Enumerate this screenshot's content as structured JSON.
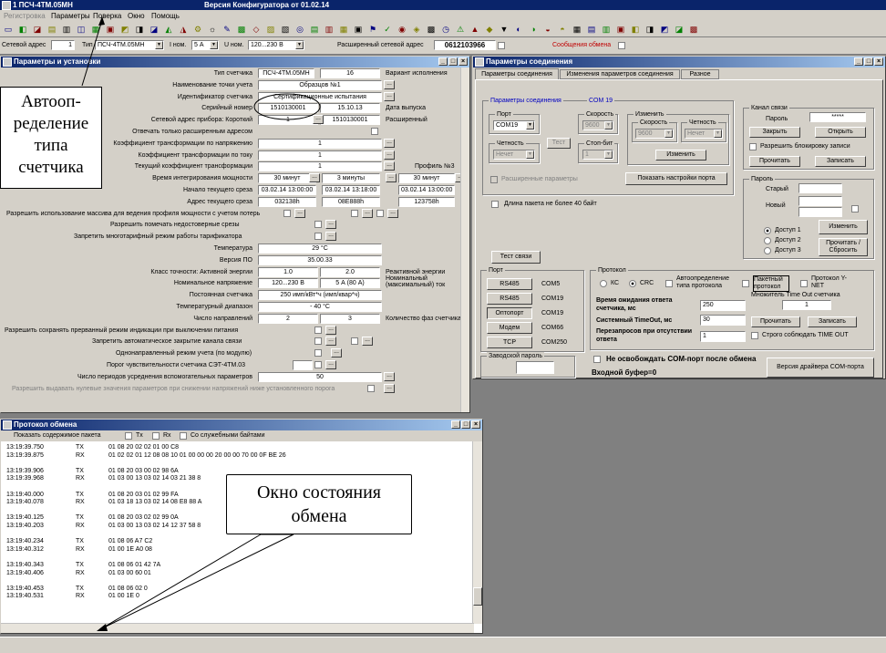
{
  "app": {
    "title": "1 ПСЧ-4ТМ.05МН",
    "center_title": "Версия Конфигуратора  от 01.02.14"
  },
  "menu": [
    "Регистровка",
    "Параметры",
    "Поверка",
    "Окно",
    "Помощь"
  ],
  "addrbar": {
    "net_addr_label": "Сетевой адрес",
    "net_addr_value": "1",
    "type_label": "Тип",
    "type_value": "ПСЧ-4ТМ.05МН",
    "inom_label": "I ном.",
    "inom_value": "5 А",
    "unom_label": "U ном.",
    "unom_value": "120...230 В",
    "ext_label": "Расширенный сетевой адрес",
    "ext_value": "0612103966",
    "msg_label": "Сообщения обмена"
  },
  "params": {
    "title": "Параметры и установки",
    "rows": [
      {
        "label": "Тип счетчика",
        "v1": "ПСЧ-4ТМ.05МН",
        "v2": "16",
        "right": "Вариант исполнения"
      },
      {
        "label": "Наименование точки учета",
        "v1": "Образцов №1"
      },
      {
        "label": "Идентификатор счетчика",
        "v1": "Сертификационные испытания"
      },
      {
        "label": "Серийный номер",
        "v1": "1510130001",
        "v2": "15.10.13",
        "right": "Дата выпуска"
      },
      {
        "label": "Сетевой адрес прибора: Короткий",
        "v1": "1",
        "v2": "1510130001",
        "right": "Расширенный"
      },
      {
        "label": "Отвечать только расширенным адресом"
      },
      {
        "label": "Коэффициент трансформации по напряжению",
        "v1": "1"
      },
      {
        "label": "Коэффициент трансформации по току",
        "v1": "1"
      },
      {
        "label": "Текущий коэффициент трансформации",
        "v1": "1",
        "right": "Профиль №3"
      },
      {
        "label": "Время интегрирования мощности",
        "v1": "30 минут",
        "v2": "3 минуты",
        "v3": "30 минут"
      },
      {
        "label": "Начало текущего среза",
        "v1": "03.02.14 13:00:00",
        "v2": "03.02.14 13:18:00",
        "v3": "03.02.14 13:00:00"
      },
      {
        "label": "Адрес текущего среза",
        "v1": "032138h",
        "v2": "08E888h",
        "v3": "123758h"
      },
      {
        "label": "Разрешить использование массива для ведения профиля мощности с учетом потерь"
      },
      {
        "label": "Разрешить помечать недостоверные срезы"
      },
      {
        "label": "Запретить многотарифный режим работы тарификатора"
      },
      {
        "label": "Температура",
        "v1": "29 °C"
      },
      {
        "label": "Версия ПО",
        "v1": "35.00.33"
      },
      {
        "label": "Класс точности: Активной энергии",
        "v1": "1.0",
        "v2": "2.0",
        "right": "Реактивной энергии"
      },
      {
        "label": "Номинальное напряжение",
        "v1": "120...230 В",
        "v2": "5 А (80 А)",
        "right": "Номинальный (максимальный) ток"
      },
      {
        "label": "Постоянная счетчика",
        "v1": "250 имп/кВт*ч (имп/квар*ч)"
      },
      {
        "label": "Температурный диапазон",
        "v1": "- 40 °C"
      },
      {
        "label": "Число направлений",
        "v1": "2",
        "v2": "3",
        "right": "Количество фаз счетчика"
      },
      {
        "label": "Разрешить сохранять прерванный режим индикации при выключении питания"
      },
      {
        "label": "Запретить автоматическое закрытие канала связи"
      },
      {
        "label": "Однонаправленный режим учета (по модулю)"
      },
      {
        "label": "Порог чувствительности счетчика СЭТ-4ТМ.03"
      },
      {
        "label": "Число периодов усреднения вспомогательных параметров",
        "v1": "50"
      },
      {
        "label": "Разрешить выдавать нулевые значения параметров при снижении напряжений ниже установленного порога"
      }
    ]
  },
  "conn": {
    "title": "Параметры соединения",
    "tabs": [
      "Параметры соединения",
      "Изменения параметров соединения",
      "Разное"
    ],
    "conn_label": "Параметры соединения",
    "com_label": "COM 19",
    "port_label": "Порт",
    "port_value": "COM19",
    "speed_label": "Скорость",
    "speed_value": "9600",
    "change_label": "Изменить",
    "speed2_label": "Скорость",
    "parity2_label": "Четность",
    "speed2_value": "9600",
    "parity2_value": "Нечет",
    "parity_label": "Четность",
    "parity_value": "Нечет",
    "stop_label": "Стоп-бит",
    "stop_value": "1",
    "test_btn": "Тест",
    "change_btn": "Изменить",
    "ext_params": "Расширенные параметры",
    "show_port": "Показать настройки порта",
    "long_packet": "Длина пакета не более 40 байт",
    "channel_label": "Канал связи",
    "password_label": "Пароль",
    "password_value": "*****",
    "close_btn": "Закрыть",
    "open_btn": "Открыть",
    "allow_lock": "Разрешить блокировку записи",
    "read_btn": "Прочитать",
    "write_btn": "Записать",
    "pass_group": "Пароль",
    "old_label": "Старый",
    "new_label": "Новый",
    "access1": "Доступ 1",
    "access2": "Доступ 2",
    "access3": "Доступ 3",
    "change_pass_btn": "Изменить",
    "read_reset_btn": "Прочитать / Сбросить",
    "test_link": "Тест связи",
    "port_group": "Порт",
    "ports": [
      {
        "btn": "RS485",
        "com": "COM5"
      },
      {
        "btn": "RS485",
        "com": "COM19"
      },
      {
        "btn": "Оптопорт",
        "com": "COM19"
      },
      {
        "btn": "Модем",
        "com": "COM66"
      },
      {
        "btn": "TCP",
        "com": "COM250"
      }
    ],
    "factory_pass": "Заводской пароль",
    "proto_group": "Протокол",
    "kc": "КС",
    "crc": "CRC",
    "auto_proto": "Автоопределение типа протокола",
    "packet_proto": "Пакетный протокол",
    "ynet": "Протокол Y-NET",
    "wait_label": "Время ожидания ответа счетчика, мс",
    "wait_value": "250",
    "systimeout_label": "Системный TimeOut, мс",
    "systimeout_value": "30",
    "retry_label": "Перезапросов при отсутствии ответа",
    "retry_value": "1",
    "mult_label": "Множитель Time Out счетчика",
    "mult_value": "1",
    "read2": "Прочитать",
    "write2": "Записать",
    "strict_timeout": "Строго соблюдать TIME OUT",
    "no_release": "Не освобождать COM-порт после обмена",
    "in_buffer": "Входной буфер=0",
    "driver_btn": "Версия драйвера COM-порта"
  },
  "log": {
    "title": "Протокол обмена",
    "show_contents": "Показать содержимое пакета",
    "tx": "Tx",
    "rx": "Rx",
    "service": "Со служебными байтами",
    "rows": [
      {
        "t": "13:19:39.750",
        "d": "TX",
        "h": "01 08 20 02 02 01 00 C8"
      },
      {
        "t": "13:19:39.875",
        "d": "RX",
        "h": "01 02 02 01 12 08 08 10 01 00 00 00 20 00 00 70 00 0F BE 26"
      },
      {
        "t": "",
        "d": "",
        "h": ""
      },
      {
        "t": "13:19:39.906",
        "d": "TX",
        "h": "01 08 20 03 00 02 98 6A"
      },
      {
        "t": "13:19:39.968",
        "d": "RX",
        "h": "01 03 00 13 03 02 14 03 21 38 8"
      },
      {
        "t": "",
        "d": "",
        "h": ""
      },
      {
        "t": "13:19:40.000",
        "d": "TX",
        "h": "01 08 20 03 01 02 99 FA"
      },
      {
        "t": "13:19:40.078",
        "d": "RX",
        "h": "01 03 18 13 03 02 14 08 E8 88 A"
      },
      {
        "t": "",
        "d": "",
        "h": ""
      },
      {
        "t": "13:19:40.125",
        "d": "TX",
        "h": "01 08 20 03 02 02 99 0A"
      },
      {
        "t": "13:19:40.203",
        "d": "RX",
        "h": "01 03 00 13 03 02 14 12 37 58 8"
      },
      {
        "t": "",
        "d": "",
        "h": ""
      },
      {
        "t": "13:19:40.234",
        "d": "TX",
        "h": "01 08 06 A7 C2"
      },
      {
        "t": "13:19:40.312",
        "d": "RX",
        "h": "01 00 1E A0 08"
      },
      {
        "t": "",
        "d": "",
        "h": ""
      },
      {
        "t": "13:19:40.343",
        "d": "TX",
        "h": "01 08 06 01 42 7A"
      },
      {
        "t": "13:19:40.406",
        "d": "RX",
        "h": "01 03 00 60 01"
      },
      {
        "t": "",
        "d": "",
        "h": ""
      },
      {
        "t": "13:19:40.453",
        "d": "TX",
        "h": "01 08 06 02 0"
      },
      {
        "t": "13:19:40.531",
        "d": "RX",
        "h": "01 00 1E 0"
      }
    ]
  },
  "callouts": {
    "auto": "Автооп- ределение типа счетчика",
    "state": "Окно состояния обмена"
  }
}
